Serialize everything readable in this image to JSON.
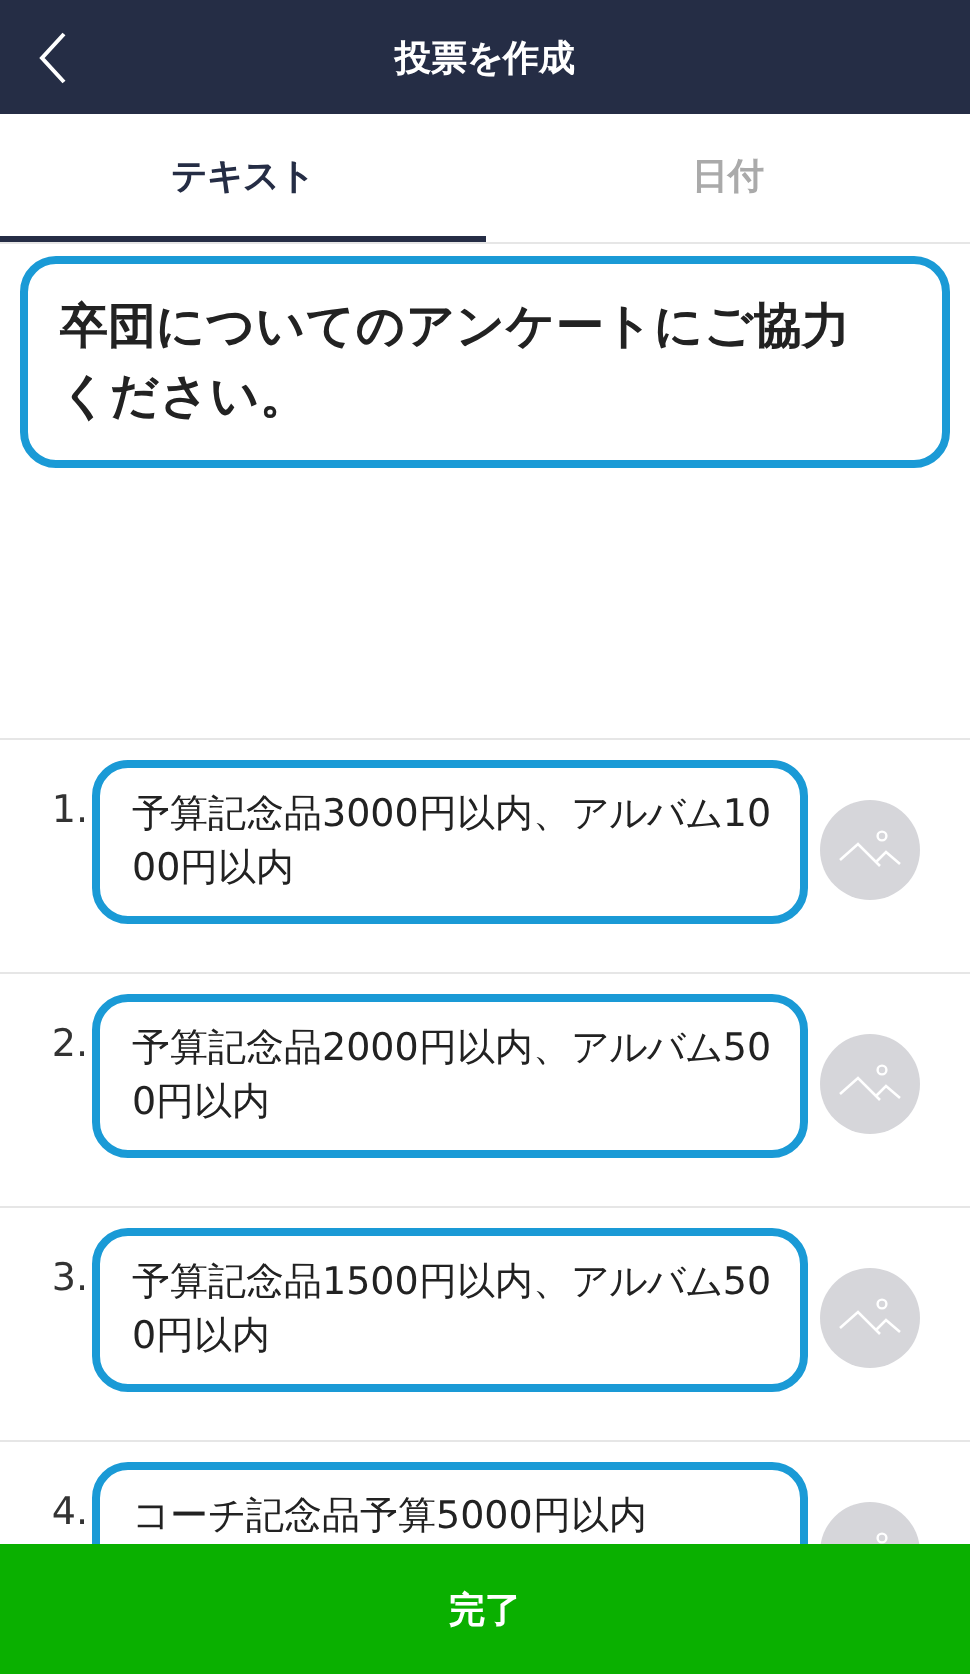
{
  "header": {
    "title": "投票を作成"
  },
  "tabs": [
    {
      "label": "テキスト",
      "selected": true
    },
    {
      "label": "日付",
      "selected": false
    }
  ],
  "question": {
    "value": "卒団についてのアンケートにご協力ください。",
    "highlighted": true
  },
  "options": [
    {
      "number": "1.",
      "value": "予算記念品3000円以内、アルバム1000円以内",
      "highlighted": true
    },
    {
      "number": "2.",
      "value": "予算記念品2000円以内、アルバム500円以内",
      "highlighted": true
    },
    {
      "number": "3.",
      "value": "予算記念品1500円以内、アルバム500円以内",
      "highlighted": true
    },
    {
      "number": "4.",
      "value": "コーチ記念品予算5000円以内",
      "highlighted": true
    }
  ],
  "done_button": "完了"
}
